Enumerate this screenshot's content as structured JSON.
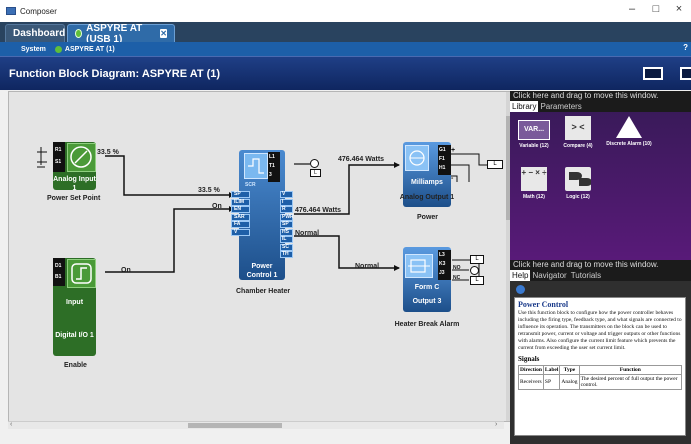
{
  "window": {
    "title": "Composer",
    "minimize": "–",
    "maximize": "□",
    "close": "×"
  },
  "tabs": [
    {
      "label": "Dashboard"
    },
    {
      "label": "ASPYRE AT (USB 1)"
    }
  ],
  "breadcrumb": {
    "system": "System",
    "device": "ASPYRE AT (1)",
    "help": "?"
  },
  "header": {
    "title": "Function Block Diagram: ASPYRE AT (1)"
  },
  "blocks": {
    "analog_input": {
      "title": "Analog Input 1",
      "caption": "Power Set Point",
      "pin_r1": "R1",
      "pin_s1": "S1",
      "out_value": "33.5 %"
    },
    "digital_io": {
      "title1": "Input",
      "title2": "Digital I/O 1",
      "caption": "Enable",
      "pin_d1": "D1",
      "pin_b1": "B1",
      "out_value": "On"
    },
    "power_control": {
      "title": "Power Control 1",
      "caption": "Chamber Heater",
      "scr": "SCR",
      "pins_top": [
        "L1",
        "T1",
        "3"
      ],
      "inputs": [
        "SP",
        "ILIM",
        "EN",
        "SAR",
        "FA",
        "V"
      ],
      "outputs": [
        "V",
        "I",
        "R",
        "PWR",
        "SP",
        "HS",
        "IL",
        "SC",
        "TH"
      ],
      "in_sp": "33.5 %",
      "in_en": "On",
      "out_pwr": "476.464 Watts",
      "out_normal": "Normal",
      "top_watts": "476.464 Watts",
      "top_pin": "L"
    },
    "analog_output": {
      "title": "Analog Output 1",
      "caption": "Power",
      "unit": "Milliamps",
      "pins": [
        "G1",
        "F1",
        "H1"
      ],
      "pin_l": "L",
      "plus": "+",
      "minus": "-"
    },
    "output3": {
      "title": "Output 3",
      "form": "Form C",
      "caption": "Heater Break Alarm",
      "pins": [
        "L3",
        "K3",
        "J3"
      ],
      "in_normal": "Normal",
      "pin_l": "L",
      "no": "NO",
      "nc": "NC"
    }
  },
  "library_panel": {
    "drag_header": "Click here and drag to move this window.",
    "tabs": [
      "Library",
      "Parameters"
    ],
    "items": [
      {
        "label": "Variable (12)",
        "icon": "var-icon",
        "icon_text": "VAR..."
      },
      {
        "label": "Compare (4)",
        "icon": "compare-icon",
        "icon_text": "> <"
      },
      {
        "label": "Discrete Alarm (10)",
        "icon": "alarm-icon",
        "icon_text": "!"
      },
      {
        "label": "Math (12)",
        "icon": "math-icon",
        "icon_text": "+ − × ÷"
      },
      {
        "label": "Logic (12)",
        "icon": "logic-icon",
        "icon_text": ""
      }
    ]
  },
  "help_panel": {
    "drag_header": "Click here and drag to move this window.",
    "tabs": [
      "Help",
      "Navigator",
      "Tutorials"
    ],
    "doc_title": "Power Control",
    "doc_text": "Use this function block to configure how the power controller behaves including the firing type, feedback type, and what signals are connected to influence its operation. The transmitters on the block can be used to retransmit power, current or voltage and trigger outputs or other functions with alarms. Also configure the current limit feature which prevents the current from exceeding the user set current limit.",
    "signals_heading": "Signals",
    "table_headers": [
      "Direction",
      "Label",
      "Type",
      "Function"
    ],
    "table_rows": [
      [
        "Receivers",
        "SP",
        "Analog",
        "The desired percent of full output the power control."
      ]
    ]
  },
  "colors": {
    "titlebar_bg": "#1f3f86",
    "green_block": "#3d8a2c",
    "blue_block": "#2f6fb8",
    "library_bg": "#4a1a6a"
  }
}
